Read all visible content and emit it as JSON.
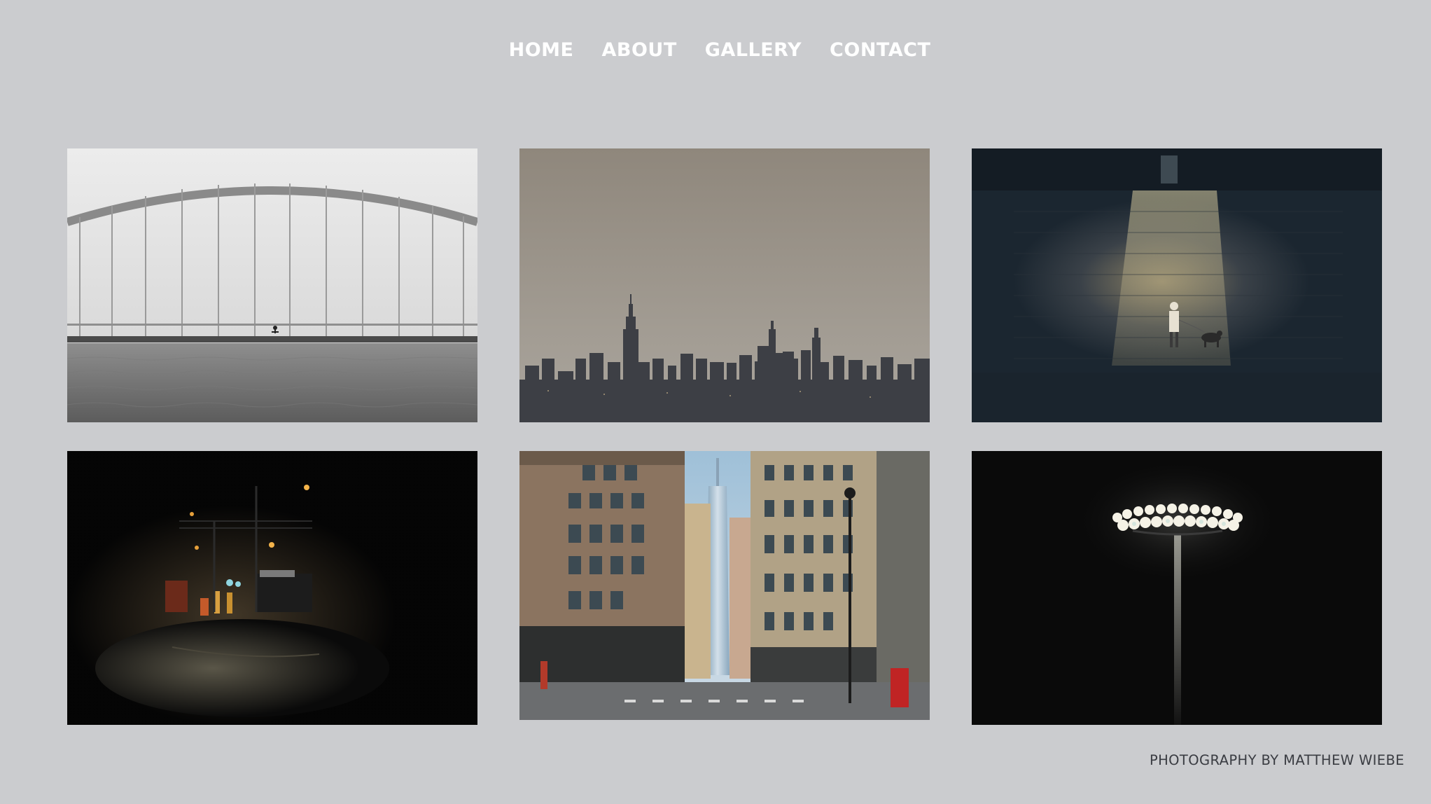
{
  "nav": {
    "items": [
      {
        "label": "HOME"
      },
      {
        "label": "ABOUT"
      },
      {
        "label": "GALLERY"
      },
      {
        "label": "CONTACT"
      }
    ]
  },
  "gallery": {
    "photos": [
      {
        "subject": "arch bridge over water with cyclist"
      },
      {
        "subject": "hazy city skyline"
      },
      {
        "subject": "person walking dog against lit stone wall"
      },
      {
        "subject": "street construction crew at night"
      },
      {
        "subject": "downtown street with skyscraper"
      },
      {
        "subject": "stadium floodlight at night"
      }
    ]
  },
  "footer": {
    "credit": "PHOTOGRAPHY BY MATTHEW WIEBE"
  },
  "colors": {
    "background": "#cbcccf",
    "nav_text": "#ffffff",
    "footer_text": "#3a3c42"
  }
}
